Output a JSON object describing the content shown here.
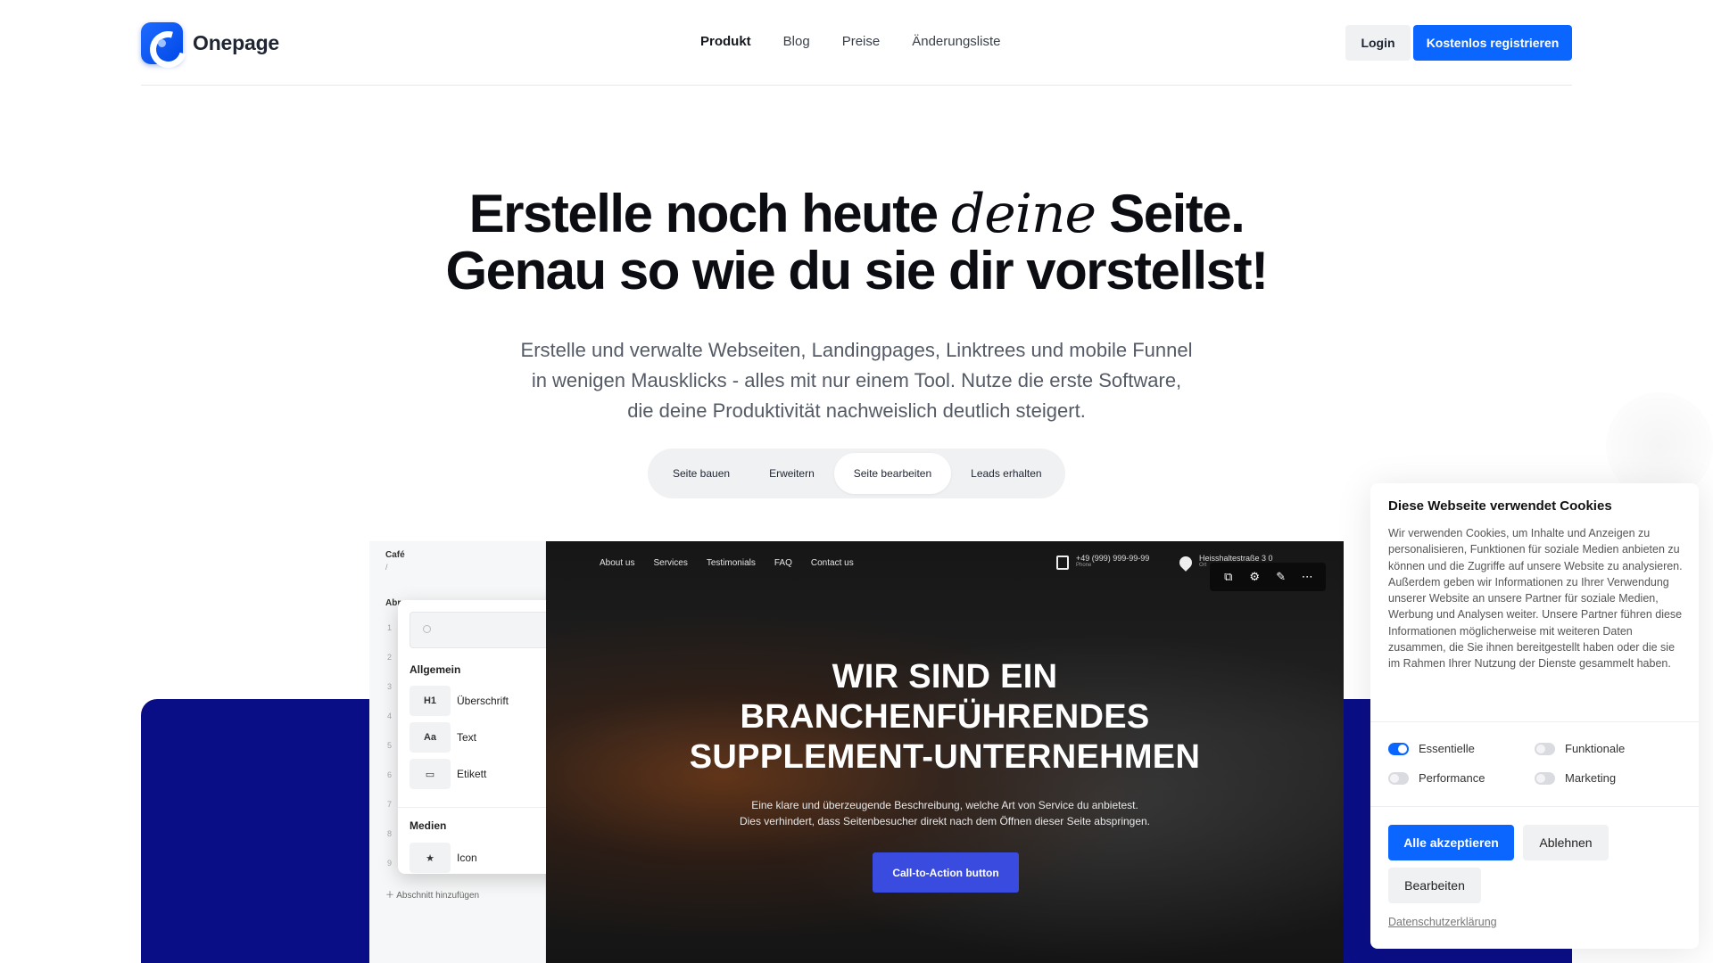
{
  "brand": {
    "name": "Onepage"
  },
  "nav": {
    "items": [
      "Produkt",
      "Blog",
      "Preise",
      "Änderungsliste"
    ]
  },
  "header": {
    "login": "Login",
    "register": "Kostenlos registrieren"
  },
  "hero": {
    "title_part1": "Erstelle noch heute ",
    "title_emph": "deine",
    "title_part2": " Seite.",
    "title_line2": "Genau so wie du sie dir vorstellst!",
    "subtitle_line1": "Erstelle und verwalte Webseiten, Landingpages, Linktrees und mobile Funnel",
    "subtitle_line2": "in wenigen Mausklicks - alles mit nur einem Tool. Nutze die erste Software,",
    "subtitle_line3": "die deine Produktivität nachweislich deutlich steigert."
  },
  "tabs": {
    "items": [
      "Seite bauen",
      "Erweitern",
      "Seite bearbeiten",
      "Leads erhalten"
    ],
    "active": "Seite bearbeiten"
  },
  "editor": {
    "sidebar": {
      "title": "Café",
      "slash": "/",
      "section": "Abr",
      "numbers": [
        "1",
        "2",
        "3",
        "4",
        "5",
        "6",
        "7",
        "8",
        "9"
      ],
      "add_section": "Abschnitt hinzufügen"
    },
    "popup": {
      "group1": "Allgemein",
      "items1": [
        {
          "icon": "H1",
          "label": "Überschrift"
        },
        {
          "icon": "Aa",
          "label": "Text"
        },
        {
          "icon": "label-icon",
          "label": "Etikett"
        }
      ],
      "group2": "Medien",
      "items2": [
        {
          "icon": "star-icon",
          "label": "Icon"
        }
      ]
    },
    "canvas": {
      "nav": [
        "About us",
        "Services",
        "Testimonials",
        "FAQ",
        "Contact us"
      ],
      "phone": "+49 (999) 999-99-99",
      "phone_label": "Phone",
      "address": "Heisshaltestraße 3 0",
      "address_label": "Ort",
      "headline_line1": "WIR SIND EIN",
      "headline_line2": "BRANCHENFÜHRENDES",
      "headline_line3": "SUPPLEMENT-UNTERNEHMEN",
      "text_line1": "Eine klare und überzeugende Beschreibung, welche Art von Service du anbietest.",
      "text_line2": "Dies verhindert, dass Seitenbesucher direkt nach dem Öffnen dieser Seite abspringen.",
      "cta": "Call-to-Action button"
    }
  },
  "cookie": {
    "title": "Diese Webseite verwendet Cookies",
    "text": "Wir verwenden Cookies, um Inhalte und Anzeigen zu personalisieren, Funktionen für soziale Medien anbieten zu können und die Zugriffe auf unsere Website zu analysieren. Außerdem geben wir Informationen zu Ihrer Verwendung unserer Website an unsere Partner für soziale Medien, Werbung und Analysen weiter. Unsere Partner führen diese Informationen möglicherweise mit weiteren Daten zusammen, die Sie ihnen bereitgestellt haben oder die sie im Rahmen Ihrer Nutzung der Dienste gesammelt haben.",
    "options": [
      {
        "label": "Essentielle",
        "on": true
      },
      {
        "label": "Funktionale",
        "on": false
      },
      {
        "label": "Performance",
        "on": false
      },
      {
        "label": "Marketing",
        "on": false
      }
    ],
    "accept": "Alle akzeptieren",
    "reject": "Ablehnen",
    "edit": "Bearbeiten",
    "privacy": "Datenschutzerklärung"
  },
  "colors": {
    "accent": "#0a66ff",
    "band": "#0a0e86",
    "cta": "#3a4ce0"
  }
}
